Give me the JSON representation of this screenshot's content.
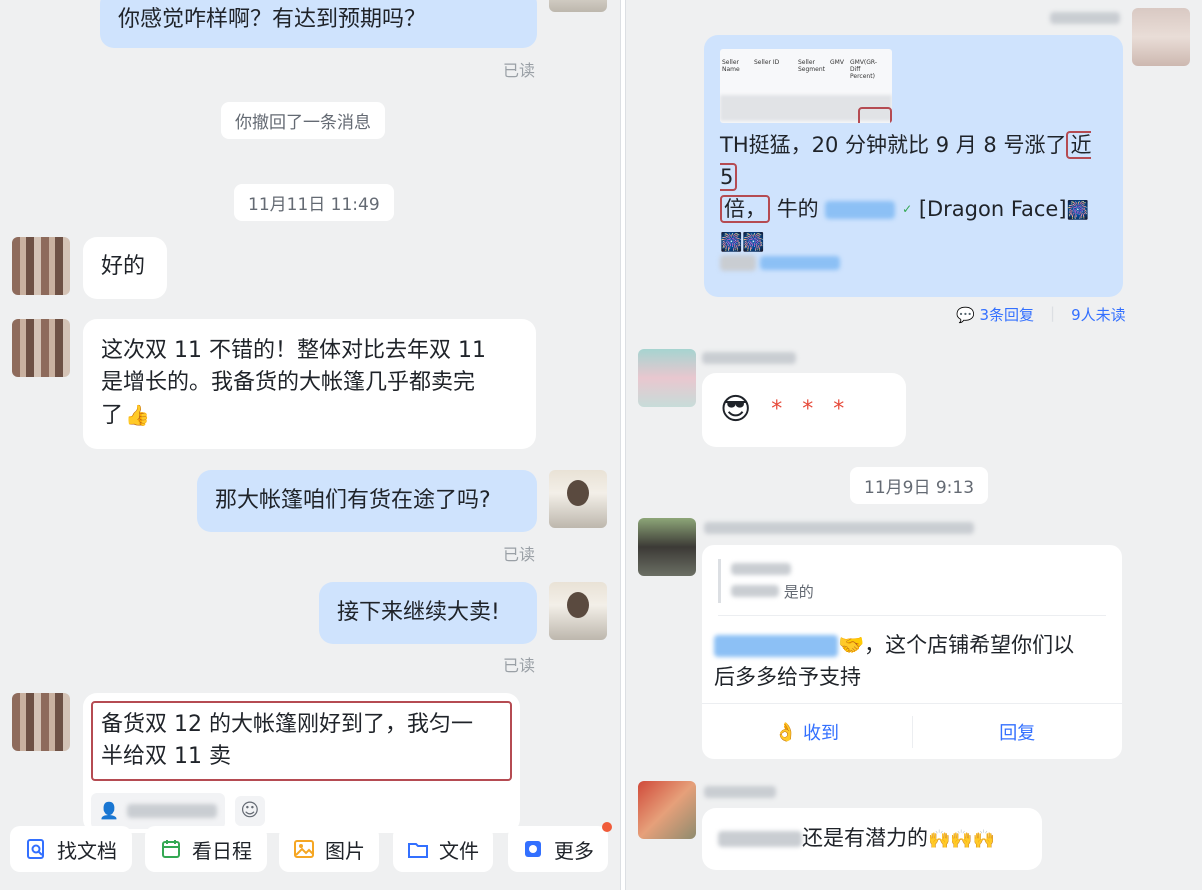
{
  "left": {
    "msg_top": "你感觉咋样啊？有达到预期吗？",
    "read1": "已读",
    "recall_notice": "你撤回了一条消息",
    "time_divider": "11月11日 11:49",
    "msg_ok": "好的",
    "msg_long_1": "这次双 11 不错的！整体对比去年双 11",
    "msg_long_2": "是增长的。我备货的大帐篷几乎都卖完",
    "msg_long_3": "了",
    "msg_tent": "那大帐篷咱们有货在途了吗?",
    "read2": "已读",
    "msg_sell": "接下来继续大卖!",
    "read3": "已读",
    "msg_stock_1": "备货双 12 的大帐篷刚好到了，我匀一",
    "msg_stock_2": "半给双 11 卖"
  },
  "toolbar": {
    "find_doc": "找文档",
    "calendar": "看日程",
    "images": "图片",
    "files": "文件",
    "more": "更多"
  },
  "right": {
    "table_headers": [
      "Seller Name",
      "Seller ID",
      "Seller Segment",
      "GMV",
      "GMV(GR-Diff Percent)"
    ],
    "msg_th_1a": "TH挺猛，20 分钟就比 9 月 8 号涨了",
    "msg_th_1b": "近 5",
    "msg_th_2a": "倍，",
    "msg_th_2b": "牛的",
    "msg_th_2c": "[Dragon Face]",
    "reply_count": "3条回复",
    "unread_count": "9人未读",
    "time_divider": "11月9日 9:13",
    "quote_reply": "是的",
    "msg_shop_1": "，这个店铺希望你们以",
    "msg_shop_2": "后多多给予支持",
    "ack_button": "收到",
    "reply_button": "回复",
    "msg_potential": "还是有潜力的"
  },
  "colors": {
    "accent": "#3370ff",
    "highlight_box": "#b54b52",
    "my_bubble": "#cfe3fd",
    "background": "#eff0f1"
  }
}
